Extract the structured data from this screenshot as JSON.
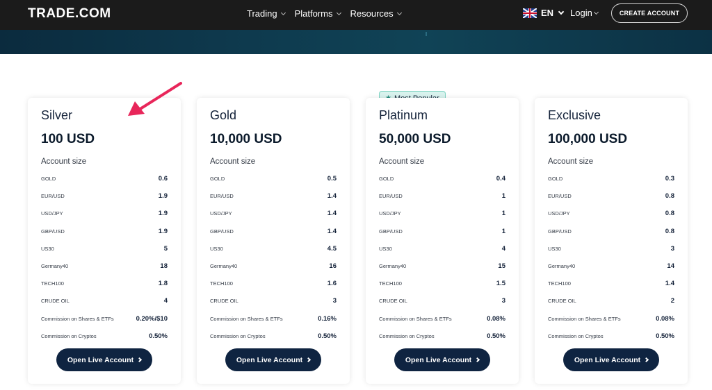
{
  "header": {
    "logo": "TRADE.COM",
    "nav": [
      {
        "label": "Trading"
      },
      {
        "label": "Platforms"
      },
      {
        "label": "Resources"
      }
    ],
    "language": "EN",
    "login": "Login",
    "create_account": "CREATE ACCOUNT"
  },
  "badge": {
    "label": "Most Popular",
    "icon": "star-icon"
  },
  "subtitle": "Account size",
  "button_label": "Open Live Account",
  "colors": {
    "header_bg": "#1b1b1b",
    "button_bg": "#0f2441",
    "badge_bg": "#d9f3ee",
    "arrow": "#e8265a"
  },
  "plans": [
    {
      "name": "Silver",
      "price": "100 USD",
      "rows": [
        {
          "label": "GOLD",
          "value": "0.6"
        },
        {
          "label": "EUR/USD",
          "value": "1.9"
        },
        {
          "label": "USD/JPY",
          "value": "1.9"
        },
        {
          "label": "GBP/USD",
          "value": "1.9"
        },
        {
          "label": "US30",
          "value": "5"
        },
        {
          "label": "Germany40",
          "value": "18"
        },
        {
          "label": "TECH100",
          "value": "1.8"
        },
        {
          "label": "CRUDE OIL",
          "value": "4"
        },
        {
          "label": "Commission on Shares & ETFs",
          "value": "0.20%/$10"
        },
        {
          "label": "Commission on Cryptos",
          "value": "0.50%"
        }
      ]
    },
    {
      "name": "Gold",
      "price": "10,000 USD",
      "rows": [
        {
          "label": "GOLD",
          "value": "0.5"
        },
        {
          "label": "EUR/USD",
          "value": "1.4"
        },
        {
          "label": "USD/JPY",
          "value": "1.4"
        },
        {
          "label": "GBP/USD",
          "value": "1.4"
        },
        {
          "label": "US30",
          "value": "4.5"
        },
        {
          "label": "Germany40",
          "value": "16"
        },
        {
          "label": "TECH100",
          "value": "1.6"
        },
        {
          "label": "CRUDE OIL",
          "value": "3"
        },
        {
          "label": "Commission on Shares & ETFs",
          "value": "0.16%"
        },
        {
          "label": "Commission on Cryptos",
          "value": "0.50%"
        }
      ]
    },
    {
      "name": "Platinum",
      "price": "50,000 USD",
      "rows": [
        {
          "label": "GOLD",
          "value": "0.4"
        },
        {
          "label": "EUR/USD",
          "value": "1"
        },
        {
          "label": "USD/JPY",
          "value": "1"
        },
        {
          "label": "GBP/USD",
          "value": "1"
        },
        {
          "label": "US30",
          "value": "4"
        },
        {
          "label": "Germany40",
          "value": "15"
        },
        {
          "label": "TECH100",
          "value": "1.5"
        },
        {
          "label": "CRUDE OIL",
          "value": "3"
        },
        {
          "label": "Commission on Shares & ETFs",
          "value": "0.08%"
        },
        {
          "label": "Commission on Cryptos",
          "value": "0.50%"
        }
      ]
    },
    {
      "name": "Exclusive",
      "price": "100,000 USD",
      "rows": [
        {
          "label": "GOLD",
          "value": "0.3"
        },
        {
          "label": "EUR/USD",
          "value": "0.8"
        },
        {
          "label": "USD/JPY",
          "value": "0.8"
        },
        {
          "label": "GBP/USD",
          "value": "0.8"
        },
        {
          "label": "US30",
          "value": "3"
        },
        {
          "label": "Germany40",
          "value": "14"
        },
        {
          "label": "TECH100",
          "value": "1.4"
        },
        {
          "label": "CRUDE OIL",
          "value": "2"
        },
        {
          "label": "Commission on Shares & ETFs",
          "value": "0.08%"
        },
        {
          "label": "Commission on Cryptos",
          "value": "0.50%"
        }
      ]
    }
  ]
}
